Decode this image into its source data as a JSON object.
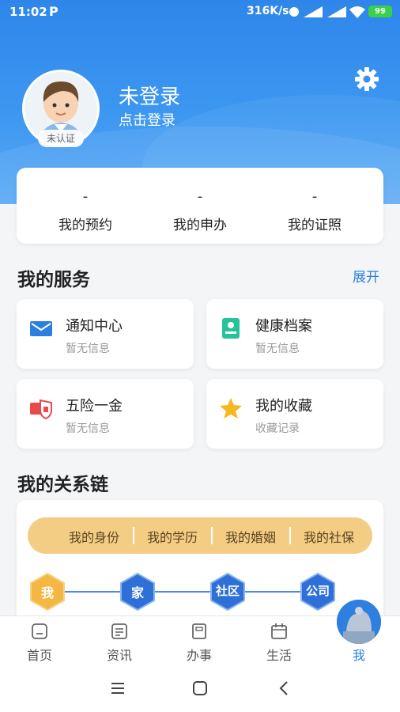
{
  "status": {
    "time": "11:02",
    "app_badge": "P",
    "speed": "316K/s",
    "battery": "99"
  },
  "profile": {
    "name": "未登录",
    "login_link": "点击登录",
    "cert_badge": "未认证"
  },
  "stats": [
    {
      "value": "-",
      "label": "我的预约"
    },
    {
      "value": "-",
      "label": "我的申办"
    },
    {
      "value": "-",
      "label": "我的证照"
    }
  ],
  "services": {
    "title": "我的服务",
    "expand_label": "展开",
    "items": [
      {
        "title": "通知中心",
        "subtitle": "暂无信息",
        "icon": "mail-icon",
        "color": "#2b7fe0"
      },
      {
        "title": "健康档案",
        "subtitle": "暂无信息",
        "icon": "health-record-icon",
        "color": "#26c39b"
      },
      {
        "title": "五险一金",
        "subtitle": "暂无信息",
        "icon": "insurance-icon",
        "color": "#e84a4a"
      },
      {
        "title": "我的收藏",
        "subtitle": "收藏记录",
        "icon": "star-icon",
        "color": "#f5b820"
      }
    ]
  },
  "chain": {
    "title": "我的关系链",
    "tags": [
      "我的身份",
      "我的学历",
      "我的婚姻",
      "我的社保"
    ],
    "nodes": [
      "我",
      "家",
      "社区",
      "公司"
    ]
  },
  "tabbar": [
    {
      "label": "首页",
      "icon": "home-icon"
    },
    {
      "label": "资讯",
      "icon": "news-icon"
    },
    {
      "label": "办事",
      "icon": "tasks-icon"
    },
    {
      "label": "生活",
      "icon": "calendar-icon"
    },
    {
      "label": "我",
      "icon": "me-icon",
      "active": true
    }
  ],
  "colors": {
    "primary": "#2b7fe0",
    "hero": "#3c97f1",
    "chain_tag_bg": "#f3cd84",
    "node_me": "#f5b744",
    "node": "#2f6fd8"
  }
}
